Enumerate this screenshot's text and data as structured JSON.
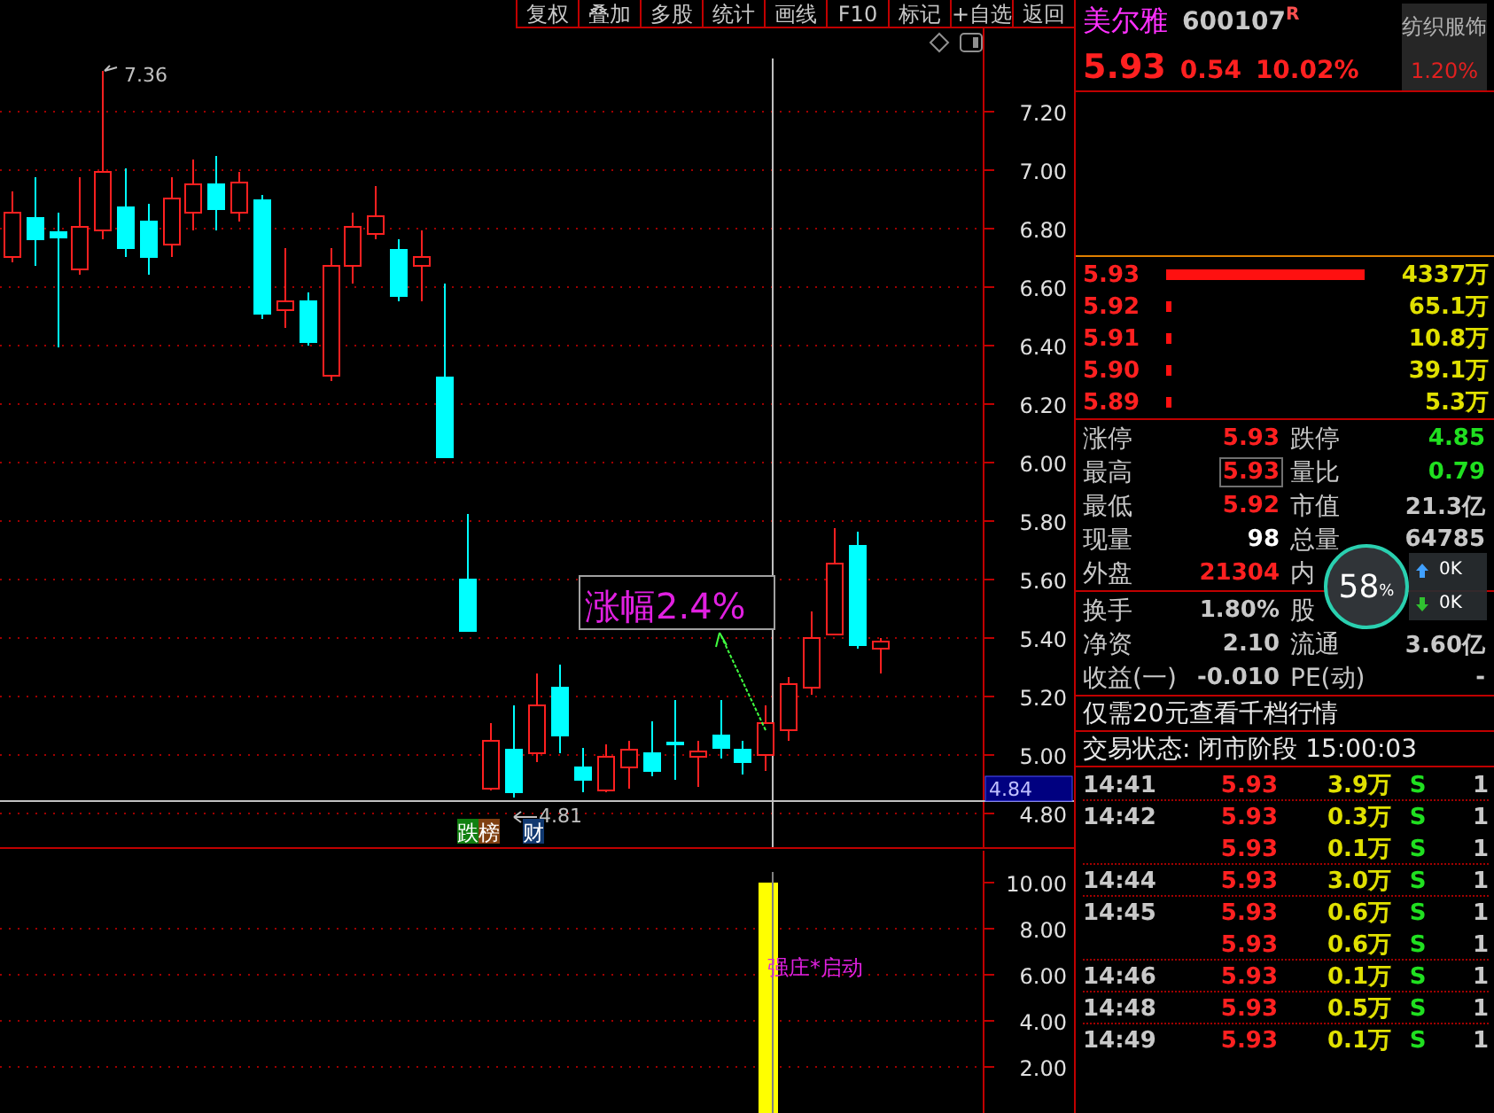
{
  "toolbar": {
    "buttons": [
      "复权",
      "叠加",
      "多股",
      "统计",
      "画线",
      "F10",
      "标记",
      "+自选",
      "返回"
    ]
  },
  "main_chart": {
    "price_ticks": [
      "7.20",
      "7.00",
      "6.80",
      "6.60",
      "6.40",
      "6.20",
      "6.00",
      "5.80",
      "5.60",
      "5.40",
      "5.20",
      "5.00",
      "4.80"
    ],
    "current_price_tag": "4.84",
    "high_marker": "7.36",
    "low_marker": "4.81",
    "callout": "涨幅2.4%",
    "markers": [
      {
        "label": "跌榜",
        "kind": "rank"
      },
      {
        "label": "财",
        "kind": "finance"
      }
    ]
  },
  "volume_chart": {
    "ticks": [
      "10.00",
      "8.00",
      "6.00",
      "4.00",
      "2.00"
    ],
    "signal_label": "强庄*启动"
  },
  "quote": {
    "name": "美尔雅",
    "code": "600107",
    "flag": "R",
    "price": "5.93",
    "change": "0.54",
    "change_pct": "10.02%",
    "sector": {
      "name": "纺织服饰",
      "change": "1.20%"
    }
  },
  "bids": [
    {
      "price": "5.93",
      "kind": "bar",
      "volume": "4337万"
    },
    {
      "price": "5.92",
      "kind": "dot",
      "volume": "65.1万"
    },
    {
      "price": "5.91",
      "kind": "dot",
      "volume": "10.8万"
    },
    {
      "price": "5.90",
      "kind": "dot",
      "volume": "39.1万"
    },
    {
      "price": "5.89",
      "kind": "dot",
      "volume": "5.3万"
    }
  ],
  "stats_top": [
    {
      "label": "涨停",
      "value": "5.93",
      "color": "#ff2020",
      "boxed": false
    },
    {
      "label": "跌停",
      "value": "4.85",
      "color": "#20e020",
      "boxed": false
    },
    {
      "label": "最高",
      "value": "5.93",
      "color": "#ff2020",
      "boxed": true
    },
    {
      "label": "量比",
      "value": "0.79",
      "color": "#20e020",
      "boxed": false
    },
    {
      "label": "最低",
      "value": "5.92",
      "color": "#ff2020",
      "boxed": false
    },
    {
      "label": "市值",
      "value": "21.3亿",
      "color": "#c8c8c8",
      "boxed": false
    },
    {
      "label": "现量",
      "value": "98",
      "color": "#ffffff",
      "boxed": false
    },
    {
      "label": "总量",
      "value": "64785",
      "color": "#c8c8c8",
      "boxed": false
    },
    {
      "label": "外盘",
      "value": "21304",
      "color": "#ff2020",
      "boxed": false
    },
    {
      "label": "内"
    }
  ],
  "stats_bottom": [
    {
      "label": "换手",
      "value": "1.80%",
      "color": "#c8c8c8",
      "boxed": false
    },
    {
      "label": "股"
    },
    {
      "label": "净资",
      "value": "2.10",
      "color": "#c8c8c8",
      "boxed": false
    },
    {
      "label": "流通",
      "value": "3.60亿",
      "color": "#c8c8c8",
      "boxed": false
    },
    {
      "label": "收益(一)",
      "value": "-0.010",
      "color": "#c8c8c8",
      "boxed": false
    },
    {
      "label": "PE(动)",
      "value": "-",
      "color": "#c8c8c8",
      "boxed": false
    }
  ],
  "promo": "仅需20元查看千档行情",
  "status": "交易状态: 闭市阶段 15:00:03",
  "trades": [
    {
      "time": "14:41",
      "price": "5.93",
      "volume": "3.9万",
      "side": "S",
      "count": "1"
    },
    {
      "time": "14:42",
      "price": "5.93",
      "volume": "0.3万",
      "side": "S",
      "count": "1"
    },
    {
      "price": "5.93",
      "volume": "0.1万",
      "side": "S",
      "count": "1"
    },
    {
      "time": "14:44",
      "price": "5.93",
      "volume": "3.0万",
      "side": "S",
      "count": "1"
    },
    {
      "time": "14:45",
      "price": "5.93",
      "volume": "0.6万",
      "side": "S",
      "count": "1"
    },
    {
      "price": "5.93",
      "volume": "0.6万",
      "side": "S",
      "count": "1"
    },
    {
      "time": "14:46",
      "price": "5.93",
      "volume": "0.1万",
      "side": "S",
      "count": "1"
    },
    {
      "time": "14:48",
      "price": "5.93",
      "volume": "0.5万",
      "side": "S",
      "count": "1"
    },
    {
      "time": "14:49",
      "price": "5.93",
      "volume": "0.1万",
      "side": "S",
      "count": "1"
    }
  ],
  "memory_widget": {
    "percent": "58",
    "unit": "%",
    "upload": "0K",
    "download": "0K"
  }
}
